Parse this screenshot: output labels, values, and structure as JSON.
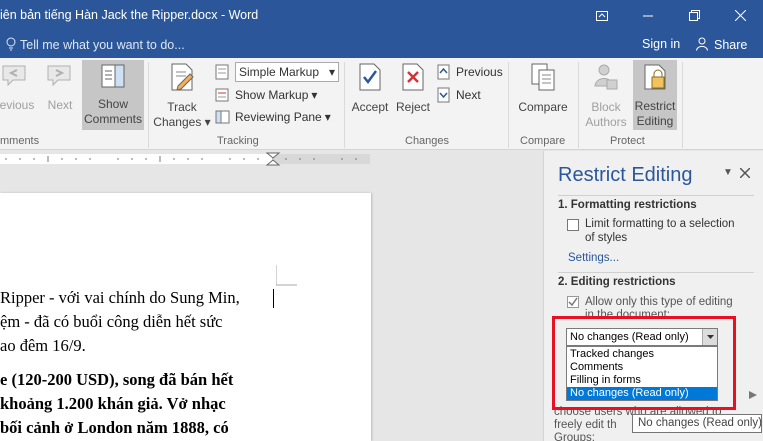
{
  "titlebar": {
    "title": "iên bản tiếng Hàn Jack the Ripper.docx - Word",
    "ribbon_display_icon": "ribbon-display-options-icon",
    "minimize_icon": "minimize-icon",
    "restore_icon": "restore-icon",
    "close_icon": "close-icon"
  },
  "tellbar": {
    "placeholder": "Tell me what you want to do...",
    "signin": "Sign in",
    "share": "Share"
  },
  "ribbon": {
    "previous_comment": "revious",
    "next_comment": "Next",
    "show_comments": [
      "Show",
      "Comments"
    ],
    "comments_group": "mments",
    "track_changes": [
      "Track",
      "Changes"
    ],
    "markup_select": "Simple Markup",
    "show_markup": "Show Markup",
    "reviewing_pane": "Reviewing Pane",
    "tracking_group": "Tracking",
    "accept": "Accept",
    "reject": "Reject",
    "previous_change": "Previous",
    "next_change": "Next",
    "changes_group": "Changes",
    "compare": "Compare",
    "compare_group": "Compare",
    "block_authors": [
      "Block",
      "Authors"
    ],
    "restrict_editing": [
      "Restrict",
      "Editing"
    ],
    "protect_group": "Protect"
  },
  "document": {
    "lines": [
      "Ripper - với vai chính do Sung Min,",
      "ệm - đã có buổi công diễn hết sức",
      "ao đêm 16/9.",
      "e (120-200 USD), song đã bán hết",
      "khoảng 1.200 khán giả. Vở nhạc",
      "bối cảnh ở London năm 1888, có"
    ]
  },
  "pane": {
    "title": "Restrict Editing",
    "section1": "1. Formatting restrictions",
    "limit_formatting": [
      "Limit formatting to a selection",
      "of styles"
    ],
    "settings_link": "Settings...",
    "section2": "2. Editing restrictions",
    "allow_only": [
      "Allow only this type of editing",
      "in the document:"
    ],
    "dropdown_selected": "No changes (Read only)",
    "dropdown_options": [
      "Tracked changes",
      "Comments",
      "Filling in forms",
      "No changes (Read only)"
    ],
    "exceptions_text": [
      "choose users who are allowed to",
      "freely edit th"
    ],
    "groups_label": "Groups:",
    "tooltip": "No changes (Read only)"
  },
  "colors": {
    "word_blue": "#2b579a",
    "highlight_red": "#e81123",
    "selection_blue": "#0078d7"
  }
}
